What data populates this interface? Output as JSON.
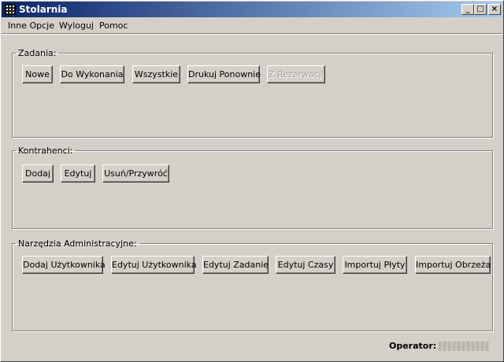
{
  "window": {
    "title": "Stolarnia",
    "controls": {
      "minimize": "_",
      "maximize": "□",
      "close": "×"
    }
  },
  "menu": {
    "items": [
      "Inne Opcje",
      "Wyloguj",
      "Pomoc"
    ]
  },
  "zadania": {
    "label": "Zadania:",
    "buttons": [
      {
        "label": "Nowe",
        "enabled": true
      },
      {
        "label": "Do Wykonania",
        "enabled": true
      },
      {
        "label": "Wszystkie",
        "enabled": true
      },
      {
        "label": "Drukuj Ponownie",
        "enabled": true
      },
      {
        "label": "Z Rezerwacji",
        "enabled": false
      }
    ]
  },
  "kontrahenci": {
    "label": "Kontrahenci:",
    "buttons": [
      {
        "label": "Dodaj",
        "enabled": true
      },
      {
        "label": "Edytuj",
        "enabled": true
      },
      {
        "label": "Usuń/Przywróć",
        "enabled": true
      }
    ]
  },
  "narzedzia": {
    "label": "Narzędzia Administracyjne:",
    "buttons": [
      {
        "label": "Dodaj Użytkownika",
        "enabled": true
      },
      {
        "label": "Edytuj Użytkownika",
        "enabled": true
      },
      {
        "label": "Edytuj Zadanie",
        "enabled": true
      },
      {
        "label": "Edytuj Czasy",
        "enabled": true
      },
      {
        "label": "Importuj Płyty",
        "enabled": true
      },
      {
        "label": "Importuj Obrzeża",
        "enabled": true
      }
    ]
  },
  "status": {
    "operator_label": "Operator:",
    "operator_value": ""
  },
  "colors": {
    "face": "#d4d0c8",
    "title_start": "#0a246a",
    "title_end": "#a6caf0",
    "disabled_text": "#a0a0a0"
  }
}
